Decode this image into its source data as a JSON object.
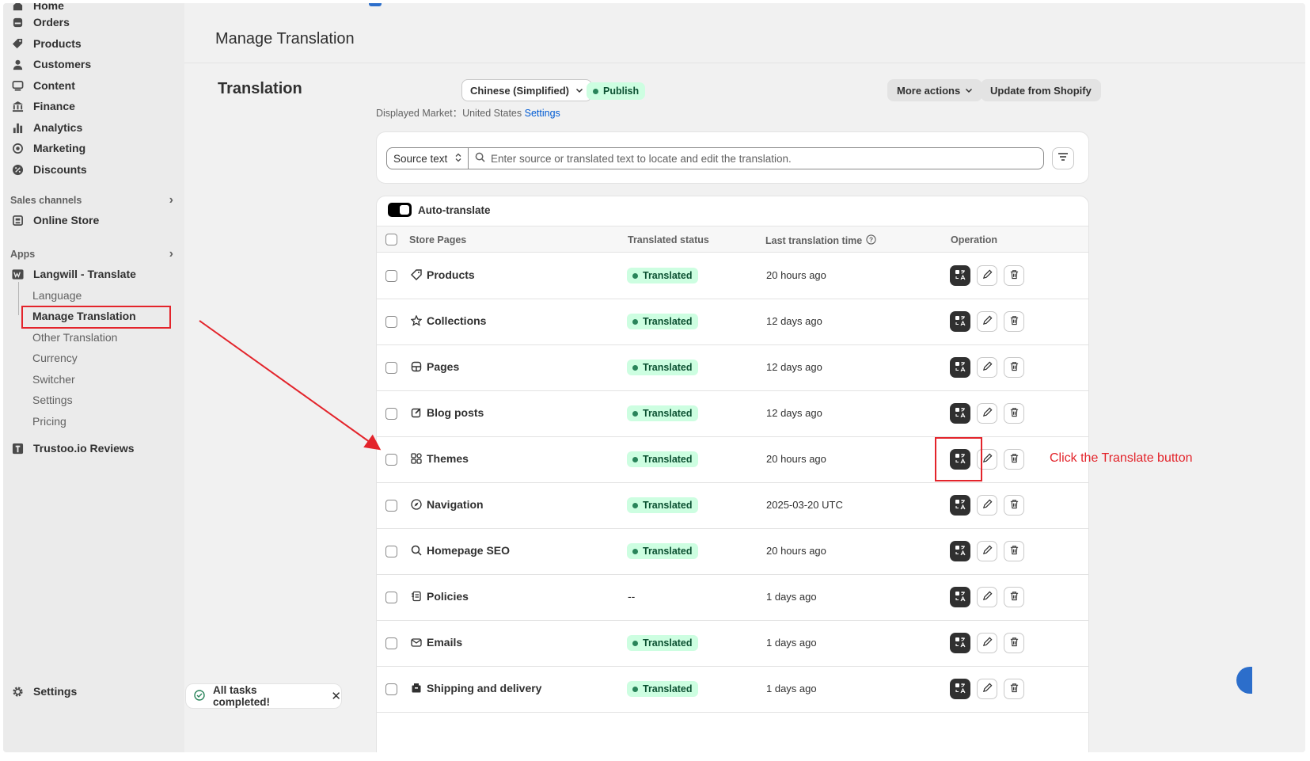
{
  "sidebar": {
    "top_partial": "Home",
    "items": [
      {
        "label": "Orders",
        "icon": "inbox-icon"
      },
      {
        "label": "Products",
        "icon": "tag-icon"
      },
      {
        "label": "Customers",
        "icon": "person-icon"
      },
      {
        "label": "Content",
        "icon": "content-icon"
      },
      {
        "label": "Finance",
        "icon": "bank-icon"
      },
      {
        "label": "Analytics",
        "icon": "bar-chart-icon"
      },
      {
        "label": "Marketing",
        "icon": "target-icon"
      },
      {
        "label": "Discounts",
        "icon": "discount-icon"
      }
    ],
    "sales_channels_label": "Sales channels",
    "online_store": "Online Store",
    "apps_label": "Apps",
    "app_name": "Langwill - Translate",
    "app_sub": [
      "Language",
      "Manage Translation",
      "Other Translation",
      "Currency",
      "Switcher",
      "Settings",
      "Pricing"
    ],
    "other_app": "Trustoo.io Reviews",
    "settings": "Settings"
  },
  "header": {
    "title": "Manage Translation"
  },
  "translation": {
    "title": "Translation",
    "language": "Chinese (Simplified)",
    "publish_badge": "Publish",
    "market_label": "Displayed Market：",
    "market_value": "United States",
    "market_link": "Settings",
    "more_actions": "More actions",
    "update_btn": "Update from Shopify"
  },
  "search": {
    "mode": "Source text",
    "placeholder": "Enter source or translated text to locate and edit the translation."
  },
  "table": {
    "auto_translate": "Auto-translate",
    "headers": {
      "pages": "Store Pages",
      "status": "Translated status",
      "time": "Last translation time",
      "op": "Operation"
    },
    "rows": [
      {
        "name": "Products",
        "status": "Translated",
        "time": "20 hours ago"
      },
      {
        "name": "Collections",
        "status": "Translated",
        "time": "12 days ago"
      },
      {
        "name": "Pages",
        "status": "Translated",
        "time": "12 days ago"
      },
      {
        "name": "Blog posts",
        "status": "Translated",
        "time": "12 days ago"
      },
      {
        "name": "Themes",
        "status": "Translated",
        "time": "20 hours ago"
      },
      {
        "name": "Navigation",
        "status": "Translated",
        "time": "2025-03-20 UTC"
      },
      {
        "name": "Homepage SEO",
        "status": "Translated",
        "time": "20 hours ago"
      },
      {
        "name": "Policies",
        "status": "--",
        "time": "1 days ago"
      },
      {
        "name": "Emails",
        "status": "Translated",
        "time": "1 days ago"
      },
      {
        "name": "Shipping and delivery",
        "status": "Translated",
        "time": "1 days ago"
      }
    ]
  },
  "annotation": {
    "text": "Click the Translate button"
  },
  "toast": {
    "text": "All tasks completed!"
  },
  "colors": {
    "accent_red": "#e3242b",
    "badge_green_bg": "#cdfee1",
    "badge_green_fg": "#0c5132",
    "link_blue": "#005bd3"
  }
}
